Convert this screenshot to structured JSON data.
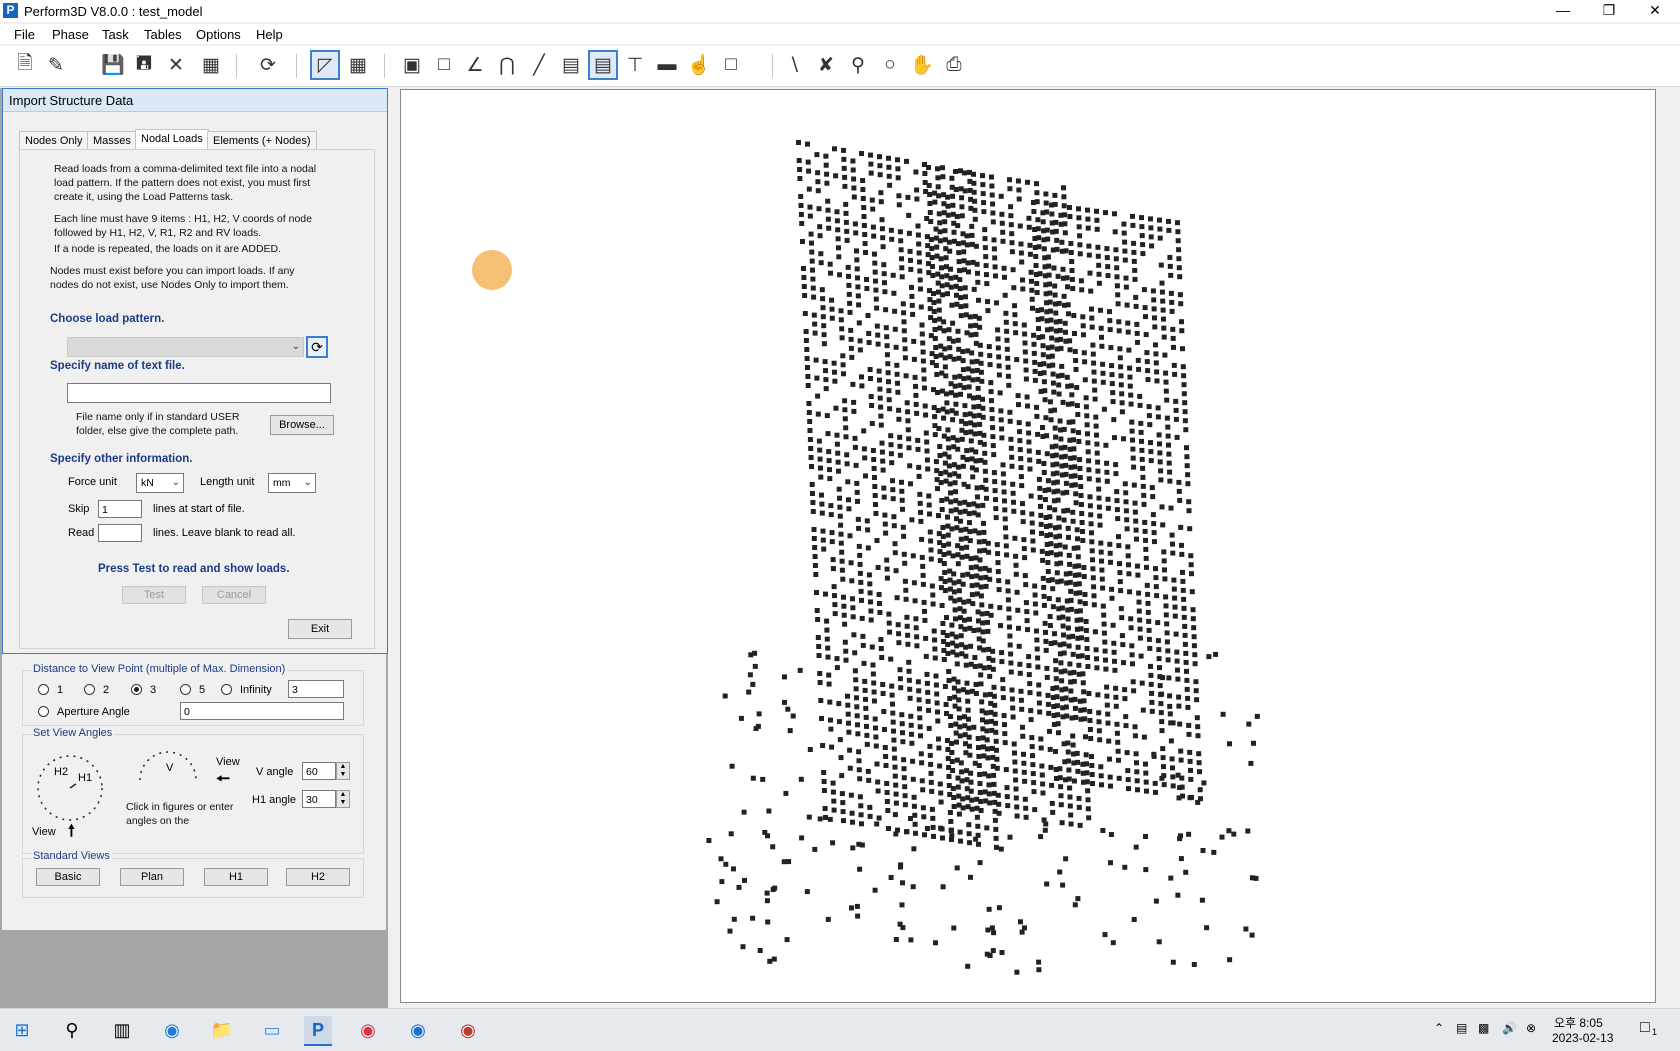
{
  "window": {
    "title": "Perform3D V8.0.0 : test_model",
    "app_icon": "P"
  },
  "menu": [
    "File",
    "Phase",
    "Task",
    "Tables",
    "Options",
    "Help"
  ],
  "dialog": {
    "title": "Import Structure Data",
    "tabs": [
      "Nodes Only",
      "Masses",
      "Nodal Loads",
      "Elements (+ Nodes)"
    ],
    "selected_tab": "Nodal Loads",
    "intro1": "Read loads from a comma-delimited text file into a nodal load pattern. If the pattern does not exist, you must first create it, using the Load Patterns task.",
    "intro2": "Each line must have 9 items : H1, H2, V coords of node followed by H1, H2, V, R1, R2 and RV loads.",
    "intro3": "If a node is repeated, the loads on it are ADDED.",
    "intro4": "Nodes must exist before you can import loads. If any nodes do not exist, use Nodes Only to import them.",
    "choose_pattern_heading": "Choose load pattern.",
    "load_pattern_value": "",
    "specify_name_heading": "Specify name of text file.",
    "file_name_value": "",
    "file_hint": "File name only if in standard USER folder, else give the complete path.",
    "browse_label": "Browse...",
    "other_info_heading": "Specify other information.",
    "force_unit_label": "Force unit",
    "force_unit_value": "kN",
    "length_unit_label": "Length unit",
    "length_unit_value": "mm",
    "skip_label": "Skip",
    "skip_value": "1",
    "skip_suffix": "lines at start of file.",
    "read_label": "Read",
    "read_value": "",
    "read_suffix": "lines. Leave blank to read all.",
    "press_test": "Press Test to read and show loads.",
    "test_label": "Test",
    "cancel_label": "Cancel",
    "exit_label": "Exit"
  },
  "view": {
    "distance_title": "Distance to View Point (multiple of Max. Dimension)",
    "distance_options": [
      "1",
      "2",
      "3",
      "5",
      "Infinity"
    ],
    "distance_selected": "3",
    "distance_value": "3",
    "aperture_label": "Aperture Angle",
    "aperture_value": "0",
    "angles_title": "Set View Angles",
    "h2_label": "H2",
    "h1_label": "H1",
    "v_label": "V",
    "view_label": "View",
    "view_label2": "View",
    "click_hint": "Click in figures or enter angles on the",
    "v_angle_label": "V angle",
    "v_angle_value": "60",
    "h1_angle_label": "H1 angle",
    "h1_angle_value": "30",
    "standard_title": "Standard Views",
    "standard_buttons": [
      "Basic",
      "Plan",
      "H1",
      "H2"
    ]
  },
  "taskbar": {
    "time": "오후 8:05",
    "date": "2023-02-13",
    "notif_count": "1"
  }
}
